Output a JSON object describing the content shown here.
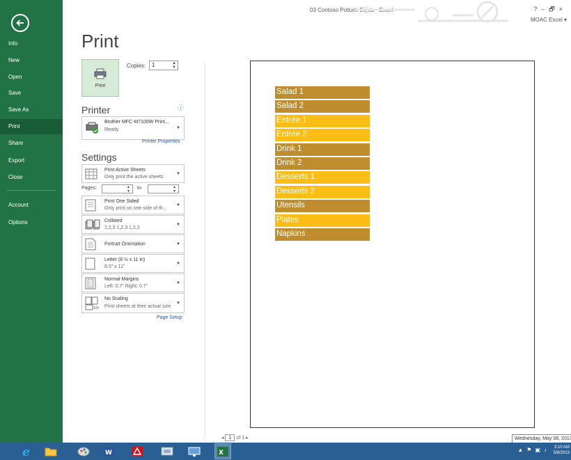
{
  "window": {
    "title": "03 Contoso Potluck Depts - Excel",
    "controls": [
      "?",
      "–",
      "🗗",
      "×"
    ],
    "account": "MOAC Excel"
  },
  "nav": {
    "items": [
      {
        "label": "Info",
        "active": false
      },
      {
        "label": "New",
        "active": false
      },
      {
        "label": "Open",
        "active": false
      },
      {
        "label": "Save",
        "active": false
      },
      {
        "label": "Save As",
        "active": false
      },
      {
        "label": "Print",
        "active": true
      },
      {
        "label": "Share",
        "active": false
      },
      {
        "label": "Export",
        "active": false
      },
      {
        "label": "Close",
        "active": false
      },
      {
        "label": "Account",
        "active": false
      },
      {
        "label": "Options",
        "active": false
      }
    ]
  },
  "print": {
    "heading": "Print",
    "button_label": "Print",
    "copies_label": "Copies:",
    "copies_value": "1"
  },
  "printer": {
    "heading": "Printer",
    "name": "Brother MFC-M7100W Print...",
    "status": "Ready",
    "properties_link": "Printer Properties"
  },
  "settings": {
    "heading": "Settings",
    "what": {
      "title": "Print Active Sheets",
      "sub": "Only print the active sheets"
    },
    "pages_label": "Pages:",
    "to_label": "to",
    "sides": {
      "title": "Print One Sided",
      "sub": "Only print on one side of th..."
    },
    "collate": {
      "title": "Collated",
      "sub": "1,2,3   1,2,3   1,2,3"
    },
    "orientation": {
      "title": "Portrait Orientation"
    },
    "paper": {
      "title": "Letter (8 ½ x 11 in)",
      "sub": "8.5\" x 11\""
    },
    "margins": {
      "title": "Normal Margins",
      "sub": "Left: 0.7\"   Right: 0.7\""
    },
    "scaling": {
      "title": "No Scaling",
      "sub": "Print sheets at their actual size"
    },
    "page_setup_link": "Page Setup"
  },
  "preview": {
    "rows": [
      {
        "text": "Salad 1",
        "color": "#bf8c2e"
      },
      {
        "text": "Salad 2",
        "color": "#bf8c2e"
      },
      {
        "text": "Entrée 1",
        "color": "#fcbd16"
      },
      {
        "text": "Entrée 2",
        "color": "#fcbd16"
      },
      {
        "text": "Drink 1",
        "color": "#bf8c2e"
      },
      {
        "text": "Drink 2",
        "color": "#bf8c2e"
      },
      {
        "text": "Desserts 1",
        "color": "#fcbd16"
      },
      {
        "text": "Desserts 2",
        "color": "#fcbd16"
      },
      {
        "text": "Utensils",
        "color": "#bf8c2e"
      },
      {
        "text": "Plates",
        "color": "#fcbd16"
      },
      {
        "text": "Napkins",
        "color": "#bf8c2e"
      }
    ],
    "pager": {
      "current": "1",
      "of": "of 1"
    }
  },
  "tooltip": "Wednesday, May 08, 2013",
  "taskbar": {
    "apps": [
      "ie-icon",
      "file-explorer-icon",
      "paint-icon",
      "word-icon",
      "acrobat-icon",
      "snipping-tool-icon",
      "remote-desktop-icon",
      "excel-icon"
    ],
    "clock_time": "3:10 AM",
    "clock_date": "5/8/2013"
  },
  "colors": {
    "nav_green": "#217346",
    "taskbar_blue": "#2a5f93",
    "row_dark": "#bf8c2e",
    "row_light": "#fcbd16"
  }
}
